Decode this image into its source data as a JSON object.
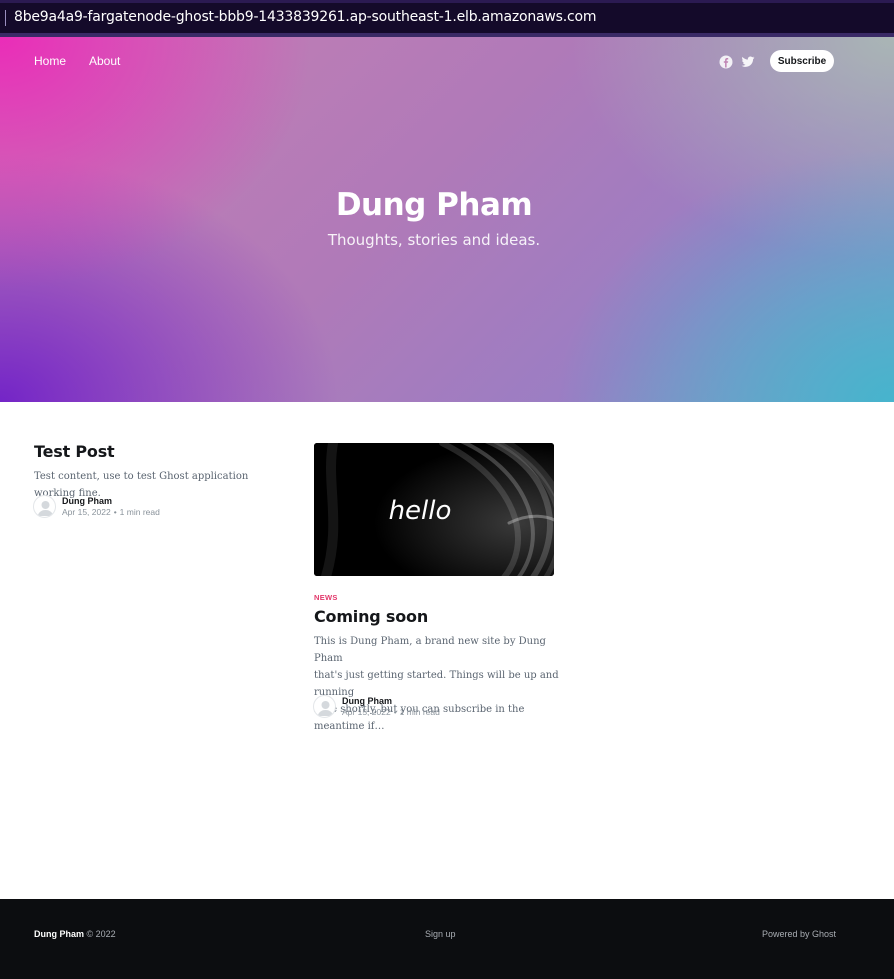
{
  "browser": {
    "url": "8be9a4a9-fargatenode-ghost-bbb9-1433839261.ap-southeast-1.elb.amazonaws.com"
  },
  "nav": {
    "items": [
      {
        "label": "Home"
      },
      {
        "label": "About"
      }
    ],
    "social_icons": [
      "facebook-icon",
      "twitter-icon"
    ],
    "subscribe_label": "Subscribe"
  },
  "hero": {
    "title": "Dung Pham",
    "description": "Thoughts, stories and ideas."
  },
  "posts": [
    {
      "title": "Test Post",
      "excerpt": "Test content, use to test Ghost application working fine.",
      "author": "Dung Pham",
      "date": "Apr 15, 2022",
      "read_time": "1 min read"
    },
    {
      "tag": "NEWS",
      "image_text": "hello",
      "title": "Coming soon",
      "excerpt_lines": [
        "This is Dung Pham, a brand new site by Dung Pham",
        "that's just getting started. Things will be up and running",
        "here shortly, but you can subscribe in the meantime if…"
      ],
      "author": "Dung Pham",
      "date": "Apr 15, 2022",
      "read_time": "1 min read"
    }
  ],
  "footer": {
    "site_name": "Dung Pham",
    "copyright": "© 2022",
    "signup_label": "Sign up",
    "powered_by": "Powered by Ghost"
  },
  "colors": {
    "accent_tag": "#e2376a",
    "footer_bg": "#0c0d10",
    "urlbar_bg": "#140a2a"
  }
}
